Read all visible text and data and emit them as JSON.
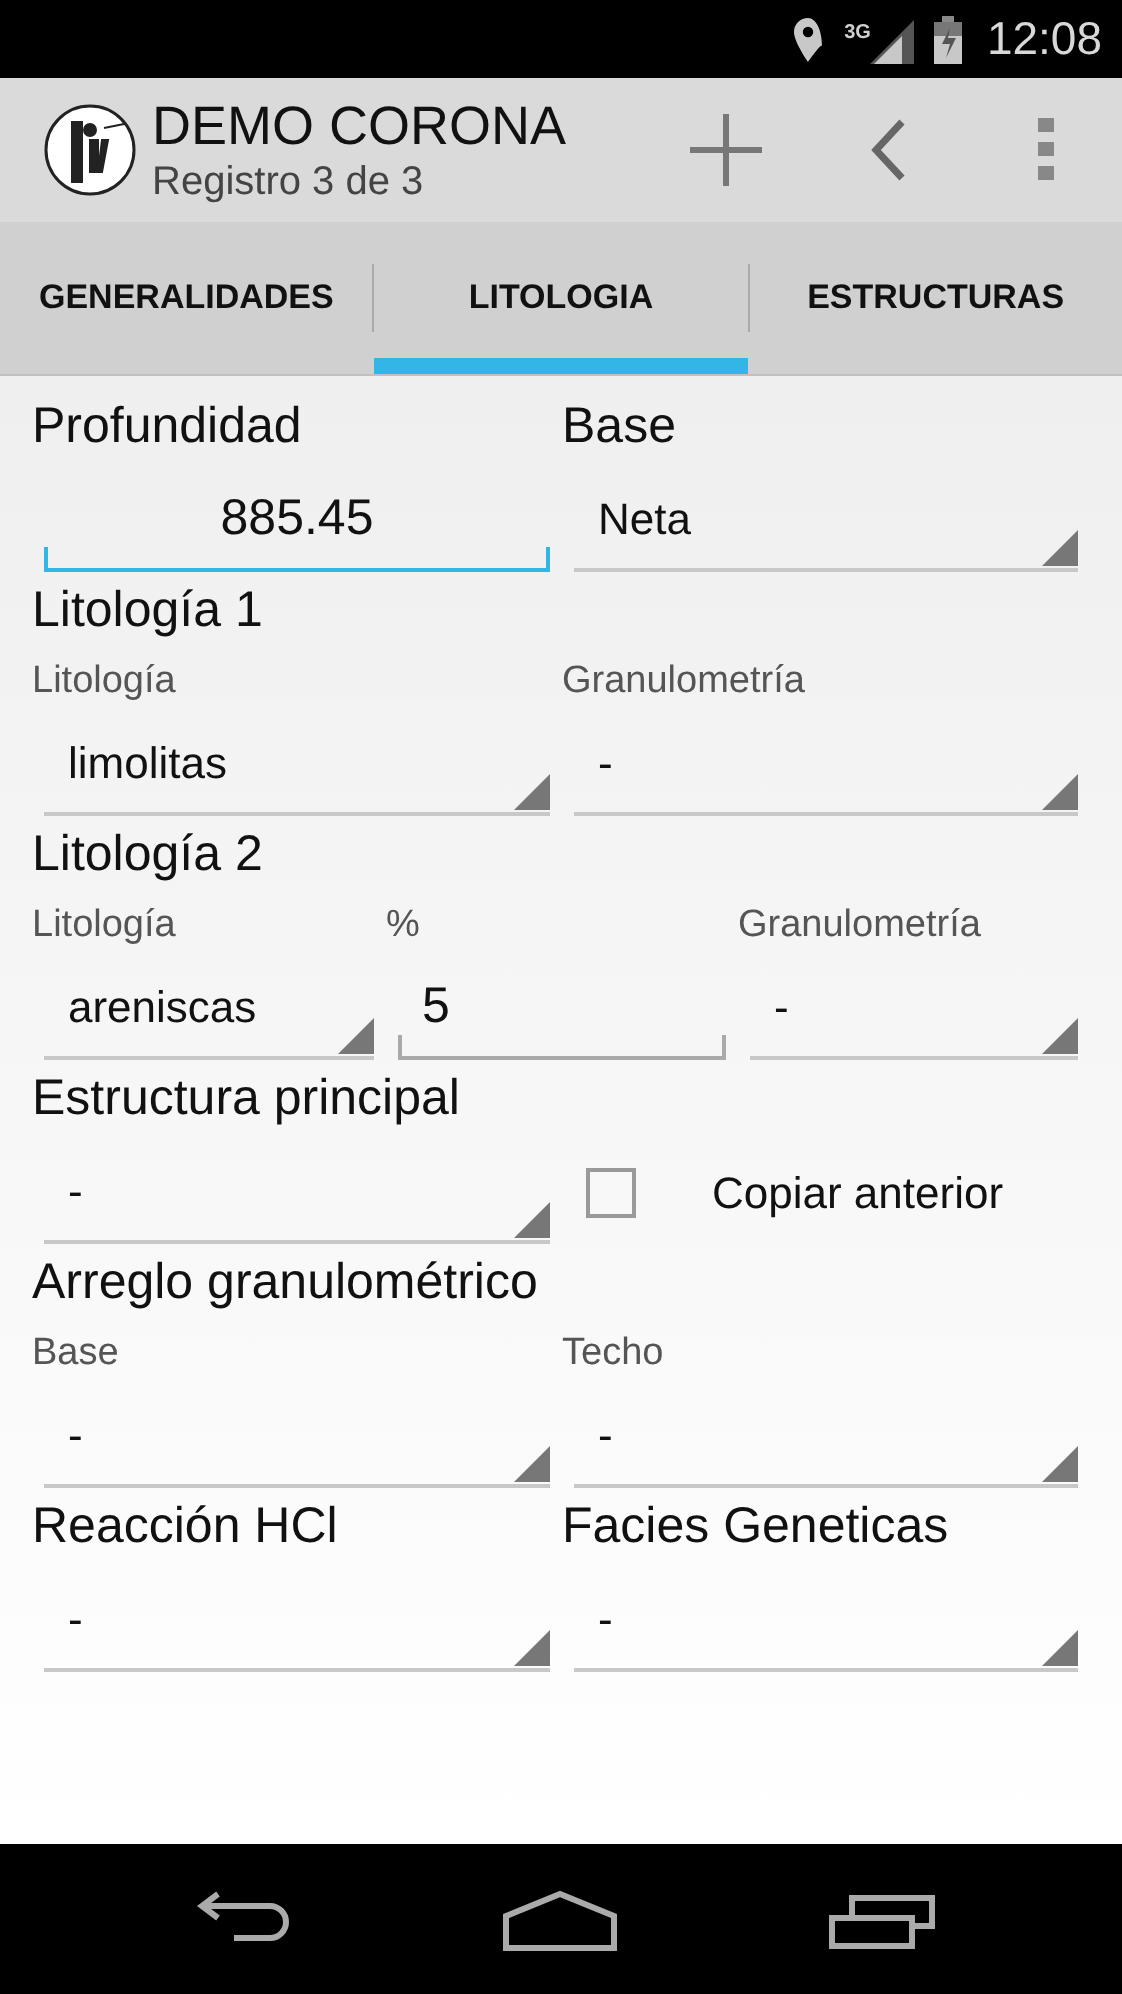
{
  "status_bar": {
    "network": "3G",
    "time": "12:08"
  },
  "action_bar": {
    "title": "DEMO CORONA",
    "subtitle": "Registro 3 de 3"
  },
  "tabs": [
    {
      "label": "GENERALIDADES",
      "selected": false
    },
    {
      "label": "LITOLOGIA",
      "selected": true
    },
    {
      "label": "ESTRUCTURAS",
      "selected": false
    }
  ],
  "form": {
    "rows": [
      {
        "items": [
          {
            "kind": "heading",
            "text": "Profundidad"
          },
          {
            "kind": "heading",
            "text": "Base"
          }
        ]
      },
      {
        "items": [
          {
            "kind": "centered_input",
            "value": "885.45",
            "focused": true
          },
          {
            "kind": "spinner",
            "value": "Neta"
          }
        ]
      },
      {
        "items": [
          {
            "kind": "heading",
            "text": "Litología 1"
          }
        ]
      },
      {
        "items": [
          {
            "kind": "label",
            "text": "Litología"
          },
          {
            "kind": "label",
            "text": "Granulometría"
          }
        ]
      },
      {
        "items": [
          {
            "kind": "spinner",
            "value": "limolitas"
          },
          {
            "kind": "spinner",
            "value": "-"
          }
        ]
      },
      {
        "items": [
          {
            "kind": "heading",
            "text": "Litología 2"
          }
        ]
      },
      {
        "items": [
          {
            "kind": "label",
            "text": "Litología"
          },
          {
            "kind": "label",
            "text": "%"
          },
          {
            "kind": "label",
            "text": "Granulometría"
          }
        ]
      },
      {
        "items": [
          {
            "kind": "spinner",
            "value": "areniscas"
          },
          {
            "kind": "text_input",
            "value": "5",
            "focused": false
          },
          {
            "kind": "spinner",
            "value": "-"
          }
        ]
      },
      {
        "items": [
          {
            "kind": "heading",
            "text": "Estructura principal"
          }
        ]
      },
      {
        "items": [
          {
            "kind": "spinner",
            "value": "-"
          },
          {
            "kind": "checkbox",
            "text": "Copiar anterior",
            "checked": false
          }
        ]
      },
      {
        "items": [
          {
            "kind": "heading",
            "text": "Arreglo granulométrico"
          }
        ]
      },
      {
        "items": [
          {
            "kind": "label",
            "text": "Base"
          },
          {
            "kind": "label",
            "text": "Techo"
          }
        ]
      },
      {
        "items": [
          {
            "kind": "spinner",
            "value": "-"
          },
          {
            "kind": "spinner",
            "value": "-"
          }
        ]
      },
      {
        "items": [
          {
            "kind": "heading",
            "text": "Reacción HCl"
          },
          {
            "kind": "heading",
            "text": "Facies Geneticas"
          }
        ]
      },
      {
        "items": [
          {
            "kind": "spinner",
            "value": "-"
          },
          {
            "kind": "spinner",
            "value": "-"
          }
        ]
      }
    ]
  }
}
